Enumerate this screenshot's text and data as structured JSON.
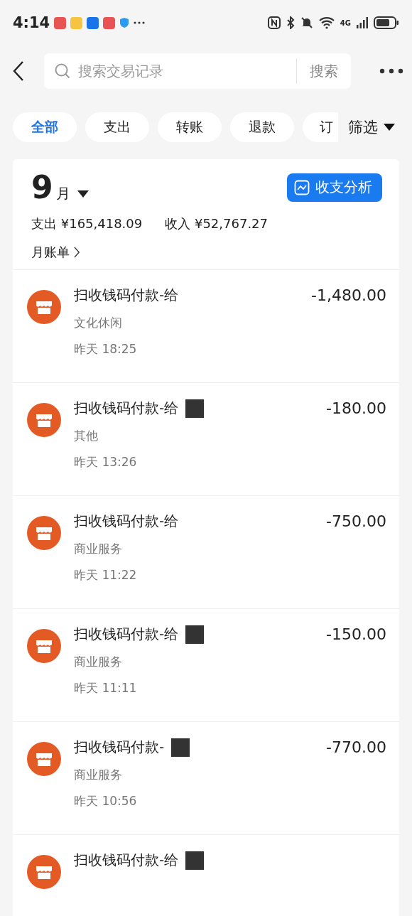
{
  "status_bar": {
    "time": "4:14",
    "network": "4G"
  },
  "search": {
    "placeholder": "搜索交易记录",
    "button": "搜索"
  },
  "filters": [
    {
      "label": "全部",
      "selected": true
    },
    {
      "label": "支出",
      "selected": false
    },
    {
      "label": "转账",
      "selected": false
    },
    {
      "label": "退款",
      "selected": false
    },
    {
      "label": "订",
      "selected": false
    }
  ],
  "filter_button": "筛选",
  "summary": {
    "month_number": "9",
    "month_unit": "月",
    "analysis_button": "收支分析",
    "expense": "支出 ¥165,418.09",
    "income": "收入 ¥52,767.27",
    "monthly_bill": "月账单"
  },
  "transactions": [
    {
      "title": "扫收钱码付款-给",
      "masked": false,
      "amount": "-1,480.00",
      "category": "文化休闲",
      "time": "昨天 18:25"
    },
    {
      "title": "扫收钱码付款-给",
      "masked": true,
      "amount": "-180.00",
      "category": "其他",
      "time": "昨天 13:26"
    },
    {
      "title": "扫收钱码付款-给",
      "masked": false,
      "amount": "-750.00",
      "category": "商业服务",
      "time": "昨天 11:22"
    },
    {
      "title": "扫收钱码付款-给",
      "masked": true,
      "amount": "-150.00",
      "category": "商业服务",
      "time": "昨天 11:11"
    },
    {
      "title": "扫收钱码付款-",
      "masked": true,
      "amount": "-770.00",
      "category": "商业服务",
      "time": "昨天 10:56"
    },
    {
      "title": "扫收钱码付款-给",
      "masked": true
    }
  ]
}
